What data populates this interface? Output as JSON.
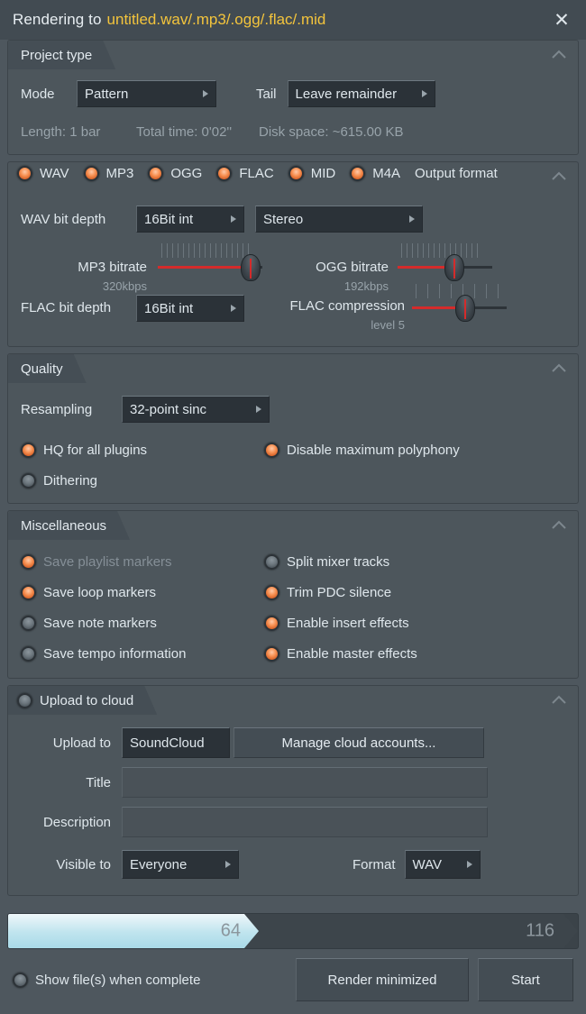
{
  "window": {
    "title_prefix": "Rendering to",
    "file_name": "untitled.wav/.mp3/.ogg/.flac/.mid",
    "close_icon": "✕",
    "accent_yellow": "#f3c43c",
    "accent_led": "#f79153",
    "panel_bg": "#4d565c",
    "field_bg": "#2b3238"
  },
  "project_type": {
    "section_title": "Project type",
    "mode_label": "Mode",
    "mode_value": "Pattern",
    "tail_label": "Tail",
    "tail_value": "Leave remainder",
    "length": "Length: 1 bar",
    "total_time": "Total time: 0'02''",
    "disk_space": "Disk space: ~615.00 KB"
  },
  "output_format": {
    "section_title": "Output format",
    "formats": [
      {
        "label": "WAV",
        "on": true
      },
      {
        "label": "MP3",
        "on": true
      },
      {
        "label": "OGG",
        "on": true
      },
      {
        "label": "FLAC",
        "on": true
      },
      {
        "label": "MID",
        "on": true
      },
      {
        "label": "M4A",
        "on": true
      }
    ],
    "wav_bit_depth_label": "WAV bit depth",
    "wav_bit_depth_value": "16Bit int",
    "wav_channels_value": "Stereo",
    "mp3_bitrate_label": "MP3 bitrate",
    "mp3_bitrate_value": "320kbps",
    "ogg_bitrate_label": "OGG bitrate",
    "ogg_bitrate_value": "192kbps",
    "flac_bit_depth_label": "FLAC bit depth",
    "flac_bit_depth_value": "16Bit int",
    "flac_compression_label": "FLAC compression",
    "flac_compression_value": "level 5"
  },
  "quality": {
    "section_title": "Quality",
    "resampling_label": "Resampling",
    "resampling_value": "32-point sinc",
    "options": [
      {
        "label": "HQ for all plugins",
        "on": true
      },
      {
        "label": "Disable maximum polyphony",
        "on": true
      },
      {
        "label": "Dithering",
        "on": false
      }
    ]
  },
  "miscellaneous": {
    "section_title": "Miscellaneous",
    "left_options": [
      {
        "label": "Save playlist markers",
        "on": true,
        "disabled": true
      },
      {
        "label": "Save loop markers",
        "on": true,
        "disabled": false
      },
      {
        "label": "Save note markers",
        "on": false,
        "disabled": false
      },
      {
        "label": "Save tempo information",
        "on": false,
        "disabled": false
      }
    ],
    "right_options": [
      {
        "label": "Split mixer tracks",
        "on": false,
        "disabled": false
      },
      {
        "label": "Trim PDC silence",
        "on": true,
        "disabled": false
      },
      {
        "label": "Enable insert effects",
        "on": true,
        "disabled": false
      },
      {
        "label": "Enable master effects",
        "on": true,
        "disabled": false
      }
    ]
  },
  "upload_cloud": {
    "section_title": "Upload to cloud",
    "enabled": false,
    "upload_to_label": "Upload to",
    "upload_to_value": "SoundCloud",
    "manage_accounts_label": "Manage cloud accounts...",
    "title_label": "Title",
    "title_value": "",
    "description_label": "Description",
    "description_value": "",
    "visible_to_label": "Visible to",
    "visible_to_value": "Everyone",
    "format_label": "Format",
    "format_value": "WAV"
  },
  "progress": {
    "left_value": "64",
    "right_value": "116",
    "percent": 44
  },
  "footer": {
    "show_files_label": "Show file(s) when complete",
    "show_files_on": false,
    "render_minimized_label": "Render minimized",
    "start_label": "Start"
  }
}
